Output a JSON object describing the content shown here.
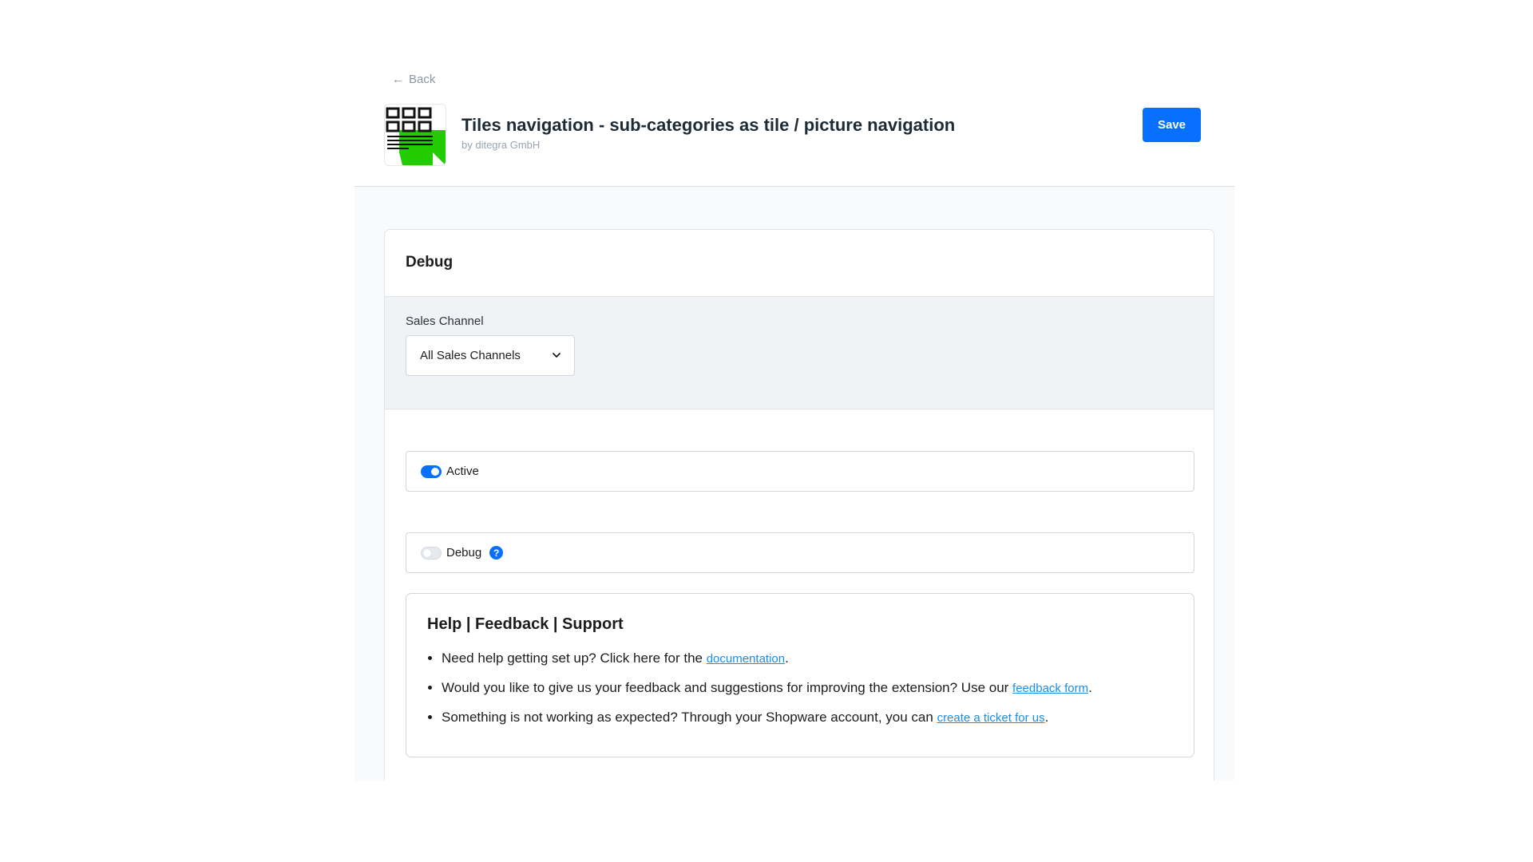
{
  "nav": {
    "back_label": "Back"
  },
  "header": {
    "title": "Tiles navigation - sub-categories as tile / picture navigation",
    "author": "by ditegra GmbH",
    "save_label": "Save"
  },
  "card": {
    "title": "Debug",
    "sales_channel": {
      "label": "Sales Channel",
      "selected": "All Sales Channels"
    },
    "fields": {
      "active": {
        "label": "Active",
        "enabled": true
      },
      "debug": {
        "label": "Debug",
        "enabled": false,
        "help_glyph": "?"
      }
    },
    "help": {
      "title": "Help | Feedback | Support",
      "items": [
        {
          "text": "Need help getting set up? Click here for the ",
          "link": "documentation",
          "suffix": "."
        },
        {
          "text": "Would you like to give us your feedback and suggestions for improving the extension? Use our ",
          "link": "feedback form",
          "suffix": "."
        },
        {
          "text": "Something is not working as expected? Through your Shopware account, you can ",
          "link": "create a ticket for us",
          "suffix": "."
        }
      ]
    }
  },
  "colors": {
    "accent": "#0870ff",
    "link": "#1a8de8",
    "logo_green": "#22cc00"
  },
  "icons": {
    "back": "arrow-left-icon",
    "dropdown": "chevron-down-icon",
    "help": "question-circle-icon",
    "logo": "tiles-grid-logo"
  }
}
